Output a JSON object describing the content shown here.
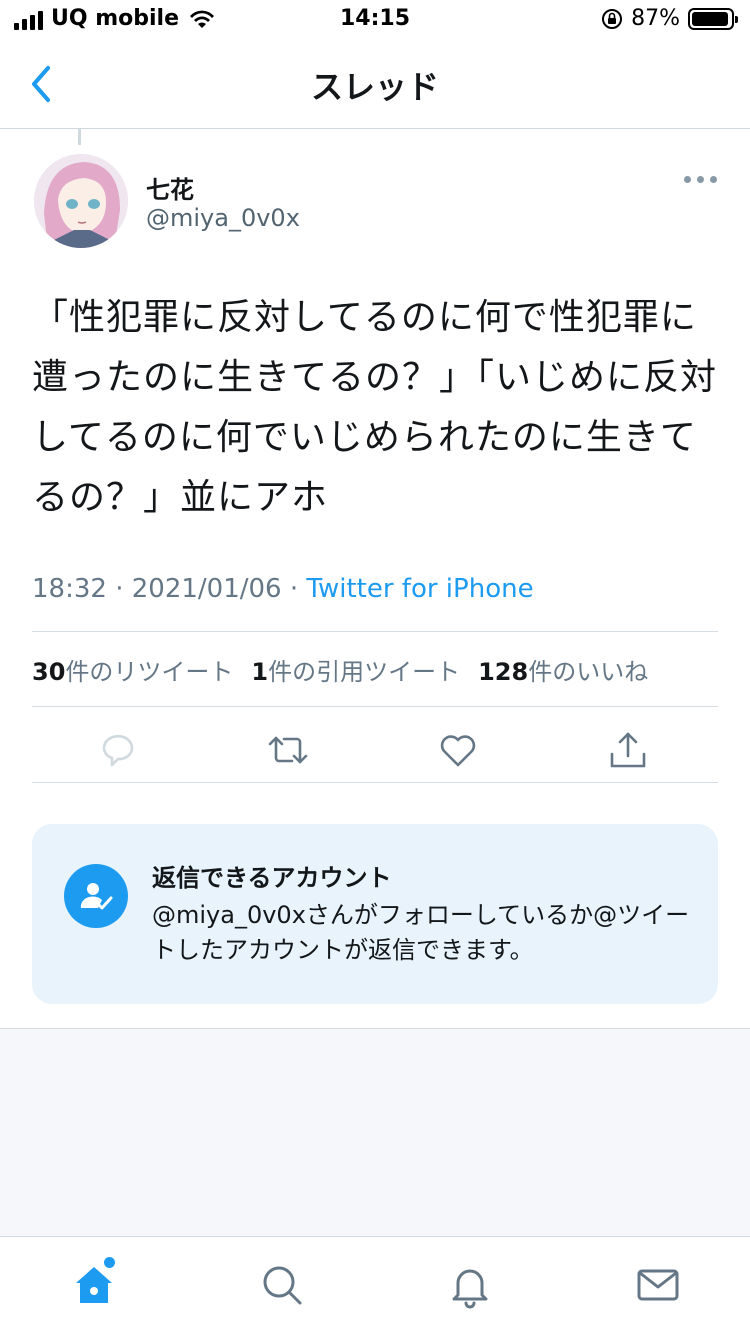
{
  "status_bar": {
    "carrier": "UQ mobile",
    "time": "14:15",
    "battery": "87%"
  },
  "header": {
    "title": "スレッド",
    "back_icon": "chevron-left-icon"
  },
  "tweet": {
    "author_name": "七花",
    "author_handle": "@miya_0v0x",
    "text": "「性犯罪に反対してるのに何で性犯罪に遭ったのに生きてるの？」「いじめに反対してるのに何でいじめられたのに生きてるの？」並にアホ",
    "time": "18:32",
    "date": "2021/01/06",
    "separator": " · ",
    "source": "Twitter for iPhone",
    "stats": {
      "retweets_count": "30",
      "retweets_label": "件のリツイート",
      "quotes_count": "1",
      "quotes_label": "件の引用ツイート",
      "likes_count": "128",
      "likes_label": "件のいいね"
    }
  },
  "reply_info": {
    "title": "返信できるアカウント",
    "body": "@miya_0v0xさんがフォローしているか@ツイートしたアカウントが返信できます。"
  },
  "tab_bar": {
    "items": [
      "home-icon",
      "search-icon",
      "notifications-icon",
      "messages-icon"
    ]
  },
  "colors": {
    "accent": "#1d9bf0",
    "card_bg": "#e8f3fc",
    "muted": "#657786"
  }
}
